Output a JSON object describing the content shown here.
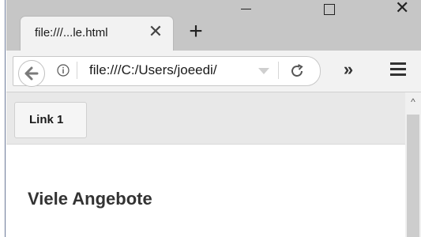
{
  "browser": {
    "tab": {
      "title": "file:///...le.html",
      "close_glyph": "✕"
    },
    "new_tab_glyph": "+",
    "window_controls": {
      "minimize": "minimize-icon",
      "maximize": "maximize-icon",
      "close": "✕"
    },
    "toolbar": {
      "url": "file:///C:/Users/joeedi/",
      "overflow_glyph": "»",
      "back_icon": "back-arrow-icon",
      "info_icon": "info-icon",
      "reload_icon": "reload-icon",
      "menu_icon": "hamburger-menu-icon"
    }
  },
  "page": {
    "nav": {
      "link1_label": "Link 1"
    },
    "heading": "Viele Angebote"
  },
  "scrollbar": {
    "up_glyph": "^"
  }
}
